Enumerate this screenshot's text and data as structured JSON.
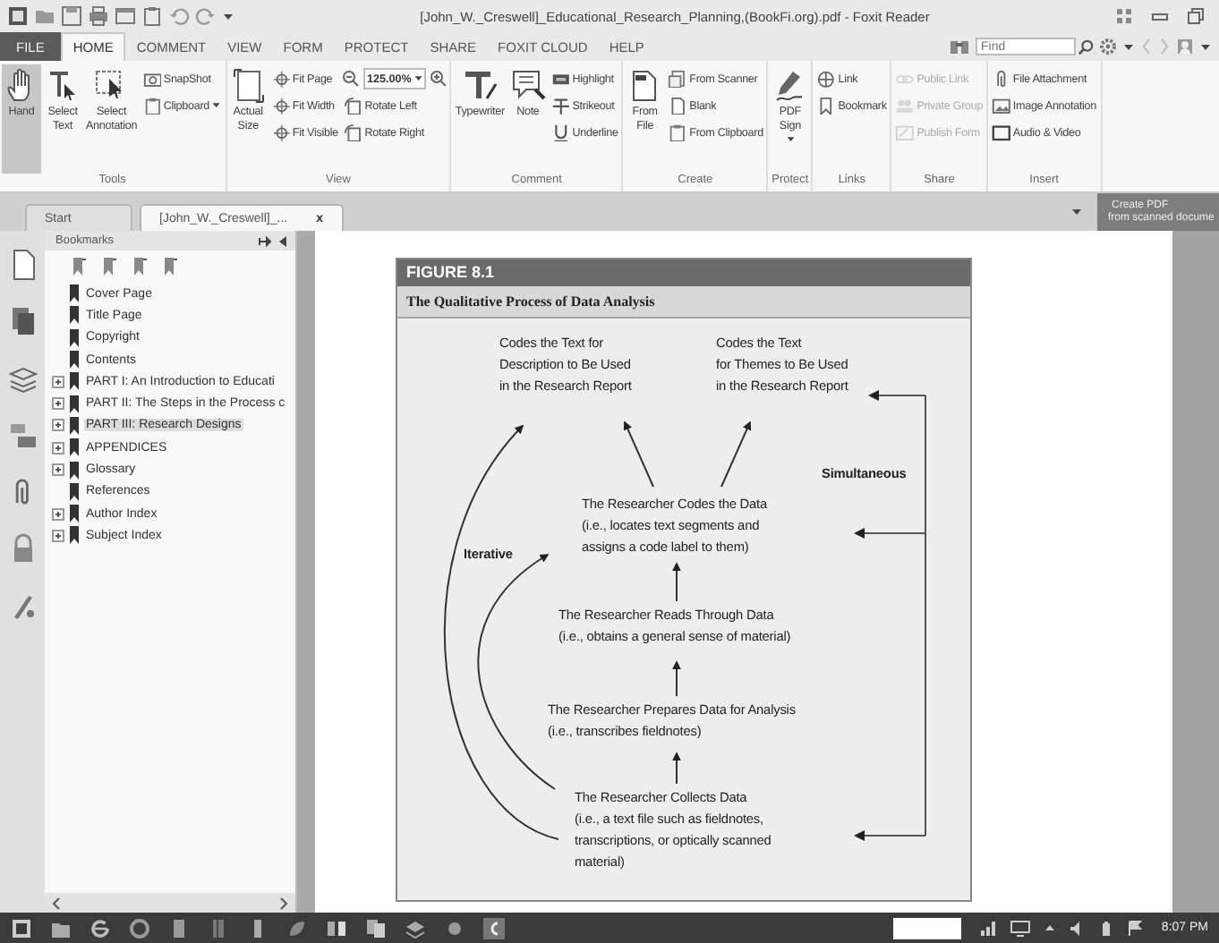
{
  "window": {
    "title": "[John_W._Creswell]_Educational_Research_Planning,(BookFi.org).pdf - Foxit Reader"
  },
  "menu": [
    {
      "kind": "file",
      "label": "FILE",
      "selected": false
    },
    {
      "kind": "tab",
      "label": "HOME",
      "selected": true
    },
    {
      "kind": "tab",
      "label": "COMMENT",
      "selected": false
    },
    {
      "kind": "tab",
      "label": "VIEW",
      "selected": false
    },
    {
      "kind": "tab",
      "label": "FORM",
      "selected": false
    },
    {
      "kind": "tab",
      "label": "PROTECT",
      "selected": false
    },
    {
      "kind": "tab",
      "label": "SHARE",
      "selected": false
    },
    {
      "kind": "tab",
      "label": "FOXIT CLOUD",
      "selected": false
    },
    {
      "kind": "tab",
      "label": "HELP",
      "selected": false
    }
  ],
  "find": {
    "placeholder": "Find"
  },
  "ribbon": [
    {
      "label": "Tools",
      "columns": [
        {
          "kind": "large",
          "label": "Hand",
          "selected": true,
          "dropdown": false
        },
        {
          "kind": "large",
          "label": "Select Text",
          "selected": false,
          "dropdown": false
        },
        {
          "kind": "large",
          "label": "Select Annotation",
          "selected": false,
          "dropdown": false
        },
        {
          "kind": "stack",
          "items": [
            {
              "kind": "button",
              "label": "SnapShot",
              "dropdown": false,
              "disabled": false
            },
            {
              "kind": "button",
              "label": "Clipboard",
              "dropdown": true,
              "disabled": false
            }
          ]
        }
      ]
    },
    {
      "label": "View",
      "columns": [
        {
          "kind": "large",
          "label": "Actual Size",
          "selected": false,
          "dropdown": false
        },
        {
          "kind": "stack",
          "items": [
            {
              "kind": "button",
              "label": "Fit Page",
              "dropdown": false,
              "disabled": false
            },
            {
              "kind": "button",
              "label": "Fit Width",
              "dropdown": false,
              "disabled": false
            },
            {
              "kind": "button",
              "label": "Fit Visible",
              "dropdown": false,
              "disabled": false
            }
          ]
        },
        {
          "kind": "stack",
          "items": [
            {
              "kind": "zoom",
              "value": "125.00%"
            },
            {
              "kind": "button",
              "label": "Rotate Left",
              "dropdown": false,
              "disabled": false
            },
            {
              "kind": "button",
              "label": "Rotate Right",
              "dropdown": false,
              "disabled": false
            }
          ]
        }
      ]
    },
    {
      "label": "Comment",
      "columns": [
        {
          "kind": "large",
          "label": "Typewriter",
          "selected": false,
          "dropdown": false
        },
        {
          "kind": "large",
          "label": "Note",
          "selected": false,
          "dropdown": false
        },
        {
          "kind": "stack",
          "items": [
            {
              "kind": "button",
              "label": "Highlight",
              "dropdown": false,
              "disabled": false
            },
            {
              "kind": "button",
              "label": "Strikeout",
              "dropdown": false,
              "disabled": false
            },
            {
              "kind": "button",
              "label": "Underline",
              "dropdown": false,
              "disabled": false
            }
          ]
        }
      ]
    },
    {
      "label": "Create",
      "columns": [
        {
          "kind": "large",
          "label": "From File",
          "selected": false,
          "dropdown": false
        },
        {
          "kind": "stack",
          "items": [
            {
              "kind": "button",
              "label": "From Scanner",
              "dropdown": false,
              "disabled": false
            },
            {
              "kind": "button",
              "label": "Blank",
              "dropdown": false,
              "disabled": false
            },
            {
              "kind": "button",
              "label": "From Clipboard",
              "dropdown": false,
              "disabled": false
            }
          ]
        }
      ]
    },
    {
      "label": "Protect",
      "columns": [
        {
          "kind": "large",
          "label": "PDF Sign",
          "selected": false,
          "dropdown": true
        }
      ]
    },
    {
      "label": "Links",
      "columns": [
        {
          "kind": "stack",
          "items": [
            {
              "kind": "button",
              "label": "Link",
              "dropdown": false,
              "disabled": false
            },
            {
              "kind": "button",
              "label": "Bookmark",
              "dropdown": false,
              "disabled": false
            }
          ]
        }
      ]
    },
    {
      "label": "Share",
      "columns": [
        {
          "kind": "stack",
          "items": [
            {
              "kind": "button",
              "label": "Public Link",
              "dropdown": false,
              "disabled": true
            },
            {
              "kind": "button",
              "label": "Private Group",
              "dropdown": false,
              "disabled": true
            },
            {
              "kind": "button",
              "label": "Publish Form",
              "dropdown": false,
              "disabled": true
            }
          ]
        }
      ]
    },
    {
      "label": "Insert",
      "columns": [
        {
          "kind": "stack",
          "items": [
            {
              "kind": "button",
              "label": "File Attachment",
              "dropdown": false,
              "disabled": false
            },
            {
              "kind": "button",
              "label": "Image Annotation",
              "dropdown": false,
              "disabled": false
            },
            {
              "kind": "button",
              "label": "Audio & Video",
              "dropdown": false,
              "disabled": false
            }
          ]
        }
      ]
    }
  ],
  "doc_tabs": [
    {
      "label": "Start",
      "selected": false
    },
    {
      "label": "[John_W._Creswell]_...",
      "selected": true,
      "close": "x"
    }
  ],
  "banner": {
    "title": "Create PDF",
    "subtitle": "from scanned docume"
  },
  "bookmarks": {
    "title": "Bookmarks",
    "items": [
      {
        "label": "Cover Page",
        "expandable": false,
        "selected": false
      },
      {
        "label": "Title Page",
        "expandable": false,
        "selected": false
      },
      {
        "label": "Copyright",
        "expandable": false,
        "selected": false
      },
      {
        "label": "Contents",
        "expandable": false,
        "selected": false
      },
      {
        "label": "PART I: An Introduction to Educati",
        "expandable": true,
        "selected": false
      },
      {
        "label": "PART II: The Steps in the Process c",
        "expandable": true,
        "selected": false
      },
      {
        "label": "PART III: Research Designs",
        "expandable": true,
        "selected": true
      },
      {
        "label": "APPENDICES",
        "expandable": true,
        "selected": false
      },
      {
        "label": "Glossary",
        "expandable": true,
        "selected": false
      },
      {
        "label": "References",
        "expandable": false,
        "selected": false
      },
      {
        "label": "Author Index",
        "expandable": true,
        "selected": false
      },
      {
        "label": "Subject Index",
        "expandable": true,
        "selected": false
      }
    ]
  },
  "figure": {
    "label": "FIGURE 8.1",
    "title": "The Qualitative Process of Data Analysis",
    "nodes": [
      {
        "kind": "step",
        "lines": [
          "Codes the Text for",
          "Description to Be Used",
          "in the Research Report"
        ]
      },
      {
        "kind": "step",
        "lines": [
          "Codes the Text",
          "for Themes to Be Used",
          "in the Research Report"
        ]
      },
      {
        "kind": "label",
        "lines": [
          "Simultaneous"
        ]
      },
      {
        "kind": "step",
        "lines": [
          "The Researcher Codes the Data",
          "(i.e., locates text segments and",
          "assigns a code label to them)"
        ]
      },
      {
        "kind": "label",
        "lines": [
          "Iterative"
        ]
      },
      {
        "kind": "step",
        "lines": [
          "The Researcher Reads Through Data",
          "(i.e., obtains a general sense of material)"
        ]
      },
      {
        "kind": "step",
        "lines": [
          "The Researcher Prepares Data for Analysis",
          "(i.e., transcribes fieldnotes)"
        ]
      },
      {
        "kind": "step",
        "lines": [
          "The Researcher Collects Data",
          "(i.e., a text file such as fieldnotes,",
          "transcriptions, or optically scanned",
          "material)"
        ]
      }
    ]
  },
  "taskbar": {
    "clock": "8:07 PM"
  }
}
